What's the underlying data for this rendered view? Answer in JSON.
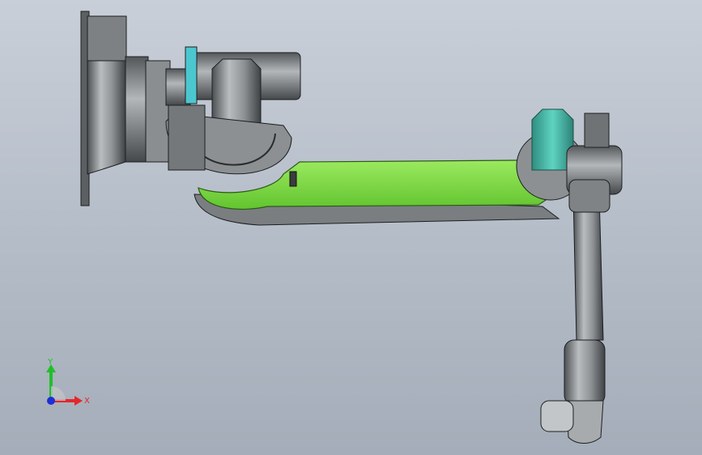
{
  "viewport": {
    "background_top": "#c9cfd8",
    "background_bottom": "#a4adb9",
    "model": {
      "accent_link_color": "#7ed84a",
      "accent_motor_color": "#3fb7a4",
      "accent_cyan_part_color": "#4cc7cf",
      "metal_color": "#8b8f92"
    }
  },
  "triad": {
    "x_label": "X",
    "y_label": "Y",
    "x_color": "#e5262a",
    "y_color": "#1fbf2a",
    "z_color": "#1d2fd6"
  }
}
